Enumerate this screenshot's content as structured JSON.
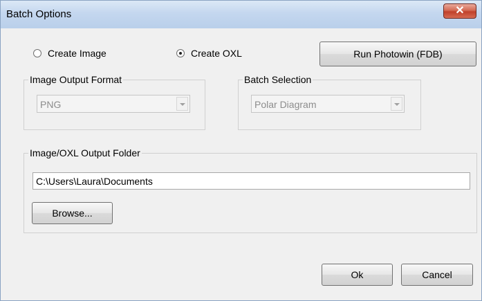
{
  "window": {
    "title": "Batch Options",
    "close_glyph": "✕"
  },
  "mode": {
    "options": [
      {
        "label": "Create Image",
        "checked": false
      },
      {
        "label": "Create OXL",
        "checked": true
      }
    ],
    "run_button_label": "Run Photowin (FDB)"
  },
  "image_format": {
    "group_label": "Image Output Format",
    "selected": "PNG"
  },
  "batch_selection": {
    "group_label": "Batch Selection",
    "selected": "Polar Diagram"
  },
  "output_folder": {
    "group_label": "Image/OXL Output Folder",
    "path": "C:\\Users\\Laura\\Documents",
    "browse_label": "Browse..."
  },
  "footer": {
    "ok_label": "Ok",
    "cancel_label": "Cancel"
  },
  "icons": {
    "close": "close-icon",
    "dropdown": "chevron-down-icon",
    "radio": "radio-icon"
  }
}
